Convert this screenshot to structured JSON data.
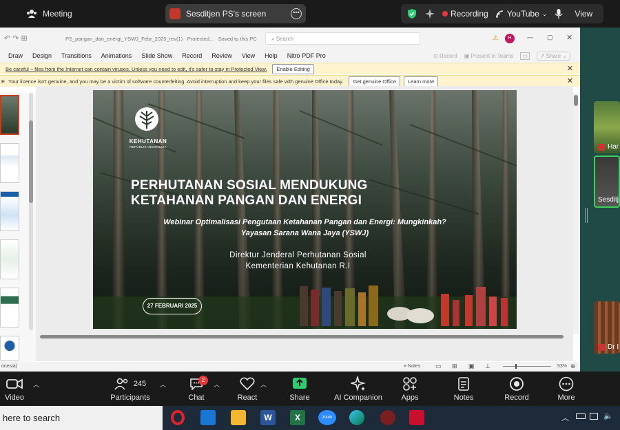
{
  "zoom": {
    "meeting_label": "Meeting",
    "share_label": "Sesditjen PS's screen",
    "recording_label": "Recording",
    "youtube_label": "YouTube",
    "view_label": "View"
  },
  "ppt": {
    "file_title": "PS_pangan_dan_energi_YSWJ_Febr_2025_rev(1)  ·  Protected...  ·  Saved to this PC",
    "search_placeholder": "Search",
    "avatar_initial": "H",
    "menu": [
      "Draw",
      "Design",
      "Transitions",
      "Animations",
      "Slide Show",
      "Record",
      "Review",
      "View",
      "Help",
      "Nitro PDF Pro"
    ],
    "record_btn": "Record",
    "present_btn": "Present in Teams",
    "share_btn": "Share",
    "protected_msg": "Be careful – files from the Internet can contain viruses. Unless you need to edit, it's safer to stay in Protected View.",
    "enable_editing": "Enable Editing",
    "licence_prefix": "E",
    "licence_msg": "Your licence isn't genuine, and you may be a victim of software counterfeiting. Avoid interruption and keep your files safe with genuine Office today.",
    "genuine_btn": "Get genuine Office",
    "learn_more": "Learn more",
    "status_lang": "onesia)",
    "notes_label": "Notes",
    "zoom_pct": "53%"
  },
  "slide": {
    "logo_text": "KEHUTANAN",
    "logo_sub": "REPUBLIK INDONESIA",
    "title_line1": "PERHUTANAN SOSIAL MENDUKUNG",
    "title_line2": "KETAHANAN PANGAN DAN ENERGI",
    "subtitle1": "Webinar Optimalisasi Pengutaan Ketahanan Pangan dan Energi: Mungkinkah?",
    "subtitle2": "Yayasan Sarana Wana Jaya (YSWJ)",
    "org1": "Direktur Jenderal Perhutanan Sosial",
    "org2": "Kementerian Kehutanan R.I",
    "date": "27 FEBRUARI 2025"
  },
  "gallery": [
    {
      "name": "Har"
    },
    {
      "name": "Sesditje"
    },
    {
      "name": "Dr I"
    }
  ],
  "controls": {
    "video": "Video",
    "participants": "Participants",
    "participant_count": "245",
    "chat": "Chat",
    "chat_badge": "2",
    "react": "React",
    "share": "Share",
    "ai": "AI Companion",
    "apps": "Apps",
    "notes": "Notes",
    "record": "Record",
    "more": "More"
  },
  "taskbar": {
    "search_text": "here to search",
    "zoom_app": "zoom"
  },
  "colors": {
    "zoom_bar": "#1a1a1a",
    "share_green": "#2ecc71",
    "record_red": "#e5383b",
    "ppt_accent": "#c43e1c"
  }
}
